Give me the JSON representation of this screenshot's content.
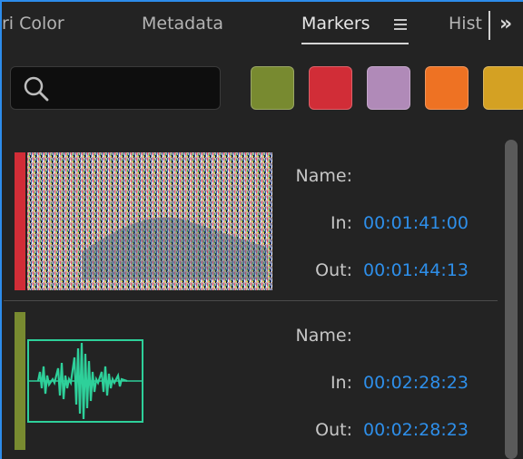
{
  "tabs": [
    {
      "label": "ri Color"
    },
    {
      "label": "Metadata"
    },
    {
      "label": "Markers"
    },
    {
      "label": "Hist"
    }
  ],
  "icons": {
    "menu": "hamburger-menu-icon",
    "overflow": "double-chevron-right-icon",
    "search": "search-icon"
  },
  "search": {
    "value": "",
    "placeholder": ""
  },
  "color_filters": [
    {
      "name": "green",
      "color": "#788a30"
    },
    {
      "name": "red",
      "color": "#d12d37"
    },
    {
      "name": "violet",
      "color": "#b08ab8"
    },
    {
      "name": "orange",
      "color": "#ee7223"
    },
    {
      "name": "yellow",
      "color": "#d4a123"
    }
  ],
  "markers": [
    {
      "color": "#d12d37",
      "thumbnail": "video-noise-thumbnail",
      "name_label": "Name:",
      "name_value": "",
      "in_label": "In:",
      "in_value": "00:01:41:00",
      "out_label": "Out:",
      "out_value": "00:01:44:13"
    },
    {
      "color": "#788a30",
      "thumbnail": "audio-waveform-thumbnail",
      "name_label": "Name:",
      "name_value": "",
      "in_label": "In:",
      "in_value": "00:02:28:23",
      "out_label": "Out:",
      "out_value": "00:02:28:23"
    }
  ]
}
